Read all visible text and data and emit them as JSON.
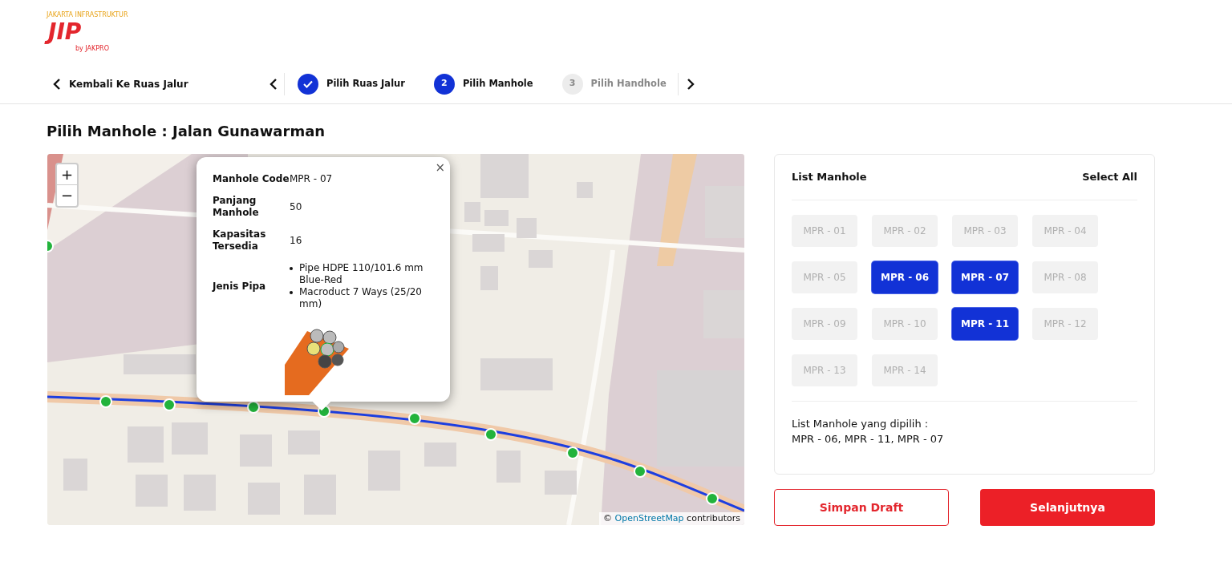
{
  "logo": {
    "tagline": "JAKARTA INFRASTRUKTUR",
    "mark": "JIP",
    "byline": "by JAKPRO"
  },
  "nav": {
    "back_label": "Kembali Ke Ruas Jalur",
    "steps": [
      {
        "label": "Pilih Ruas Jalur",
        "done": true,
        "selected": false
      },
      {
        "number": "2",
        "label": "Pilih Manhole",
        "done": false,
        "selected": true
      },
      {
        "number": "3",
        "label": "Pilih Handhole",
        "done": false,
        "selected": false
      }
    ]
  },
  "page_title": "Pilih Manhole : Jalan Gunawarman",
  "map": {
    "zoom_in": "+",
    "zoom_out": "−",
    "attribution_prefix": "©",
    "attribution_link": "OpenStreetMap",
    "attribution_suffix": "contributors",
    "popup": {
      "close": "×",
      "fields": [
        {
          "label": "Manhole Code",
          "value": "MPR - 07"
        },
        {
          "label": "Panjang Manhole",
          "value": "50"
        },
        {
          "label": "Kapasitas Tersedia",
          "value": "16"
        }
      ],
      "pipe_label": "Jenis Pipa",
      "pipes": [
        "Pipe HDPE 110/101.6 mm Blue-Red",
        "Macroduct 7 Ways (25/20 mm)"
      ]
    }
  },
  "panel": {
    "title": "List Manhole",
    "select_all": "Select All",
    "manholes": [
      {
        "label": "MPR - 01",
        "selected": false
      },
      {
        "label": "MPR - 02",
        "selected": false
      },
      {
        "label": "MPR - 03",
        "selected": false
      },
      {
        "label": "MPR - 04",
        "selected": false
      },
      {
        "label": "MPR - 05",
        "selected": false
      },
      {
        "label": "MPR - 06",
        "selected": true
      },
      {
        "label": "MPR - 07",
        "selected": true
      },
      {
        "label": "MPR - 08",
        "selected": false
      },
      {
        "label": "MPR - 09",
        "selected": false
      },
      {
        "label": "MPR - 10",
        "selected": false
      },
      {
        "label": "MPR - 11",
        "selected": true
      },
      {
        "label": "MPR - 12",
        "selected": false
      },
      {
        "label": "MPR - 13",
        "selected": false
      },
      {
        "label": "MPR - 14",
        "selected": false
      }
    ],
    "selected_heading": "List Manhole yang dipilih :",
    "selected_list": "MPR - 06, MPR - 11, MPR - 07"
  },
  "actions": {
    "draft": "Simpan Draft",
    "next": "Selanjutnya"
  }
}
